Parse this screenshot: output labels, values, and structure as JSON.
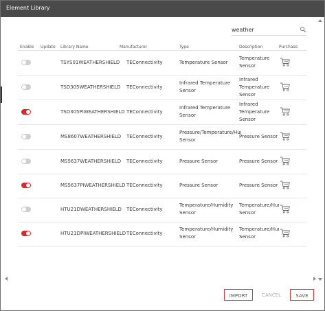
{
  "window": {
    "title": "Element Library"
  },
  "search": {
    "value": "weather",
    "icon": "search-icon"
  },
  "columns": {
    "enable": "Enable",
    "update": "Update",
    "library_name": "Library Name",
    "manufacturer": "Manufacturer",
    "type": "Type",
    "description": "Description",
    "purchase": "Purchase"
  },
  "rows": [
    {
      "enabled": false,
      "library_name": "TSYS01WEATHERSHIELD",
      "manufacturer": "TEConnectivity",
      "type": "Temperature Sensor",
      "description": "Temperature Sensor",
      "purchase_icon": "cart-icon"
    },
    {
      "enabled": false,
      "library_name": "TSD305WEATHERSHIELD",
      "manufacturer": "TEConnectivity",
      "type": "Infrared Temperature Sensor",
      "description": "Infrared Temperature Sensor",
      "purchase_icon": "cart-icon"
    },
    {
      "enabled": true,
      "library_name": "TSD305PIWEATHERSHIELD",
      "manufacturer": "TEConnectivity",
      "type": "Infrared Temperature Sensor",
      "description": "Infrared Temperature Sensor",
      "purchase_icon": "cart-icon"
    },
    {
      "enabled": false,
      "library_name": "MS8607WEATHERSHIELD",
      "manufacturer": "TEConnectivity",
      "type": "Pressure/Temperature/Humidity Sensor",
      "description": "Pressure Sensor",
      "purchase_icon": "cart-icon"
    },
    {
      "enabled": false,
      "library_name": "MS5637WEATHERSHIELD",
      "manufacturer": "TEConnectivity",
      "type": "Pressure Sensor",
      "description": "Pressure Sensor",
      "purchase_icon": "cart-icon"
    },
    {
      "enabled": true,
      "library_name": "MS5637PIWEATHERSHIELD",
      "manufacturer": "TEConnectivity",
      "type": "Pressure Sensor",
      "description": "Pressure Sensor",
      "purchase_icon": "cart-icon"
    },
    {
      "enabled": false,
      "library_name": "HTU21DWEATHERSHIELD",
      "manufacturer": "TEConnectivity",
      "type": "Temperature/Humidity Sensor",
      "description": "Temperature/Humidity Sensor",
      "purchase_icon": "cart-icon"
    },
    {
      "enabled": true,
      "library_name": "HTU21DPIWEATHERSHIELD",
      "manufacturer": "TEConnectivity",
      "type": "Temperature/Humidity Sensor",
      "description": "Temperature/Humidity Sensor",
      "purchase_icon": "cart-icon"
    }
  ],
  "buttons": {
    "import": "IMPORT",
    "cancel": "CANCEL",
    "save": "SAVE"
  },
  "colors": {
    "titlebar": "#4a4a4a",
    "toggle_on": "#e0262a",
    "toggle_off": "#cfcfcf",
    "button_border": "#e03a3a"
  }
}
